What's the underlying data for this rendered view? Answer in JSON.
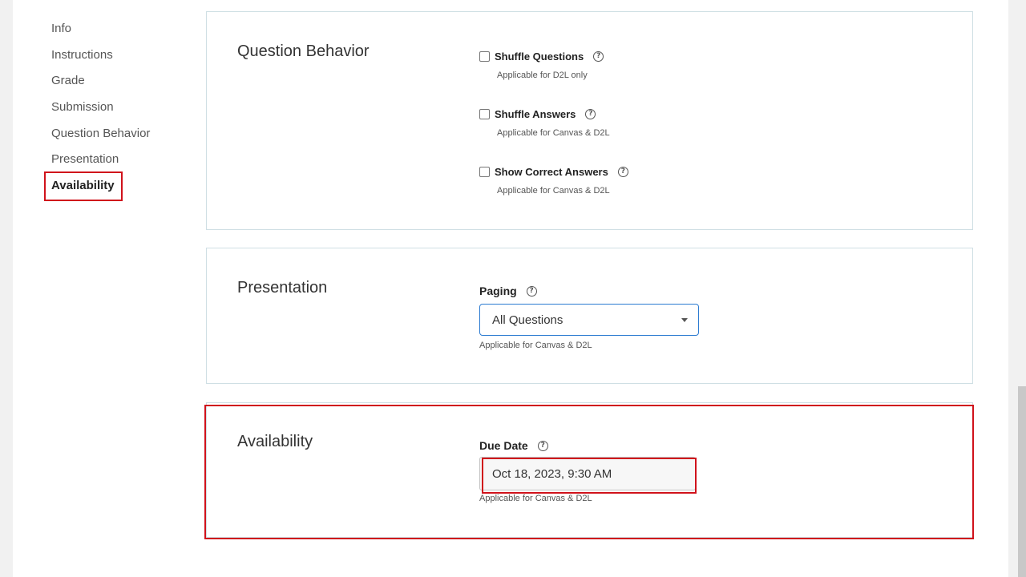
{
  "sidebar": {
    "items": [
      {
        "label": "Info"
      },
      {
        "label": "Instructions"
      },
      {
        "label": "Grade"
      },
      {
        "label": "Submission"
      },
      {
        "label": "Question Behavior"
      },
      {
        "label": "Presentation"
      },
      {
        "label": "Availability"
      }
    ],
    "active": "Availability"
  },
  "question_behavior": {
    "title": "Question Behavior",
    "options": [
      {
        "label": "Shuffle Questions",
        "checked": false,
        "hint": "Applicable for D2L only"
      },
      {
        "label": "Shuffle Answers",
        "checked": false,
        "hint": "Applicable for Canvas & D2L"
      },
      {
        "label": "Show Correct Answers",
        "checked": false,
        "hint": "Applicable for Canvas & D2L"
      }
    ]
  },
  "presentation": {
    "title": "Presentation",
    "paging_label": "Paging",
    "paging_value": "All Questions",
    "hint": "Applicable for Canvas & D2L"
  },
  "availability": {
    "title": "Availability",
    "due_date_label": "Due Date",
    "due_date_value": "Oct 18, 2023, 9:30 AM",
    "hint": "Applicable for Canvas & D2L"
  },
  "icons": {
    "help": "help-circle-icon",
    "dropdown": "chevron-down-icon"
  },
  "colors": {
    "highlight": "#d0121b",
    "focus_border": "#2c7bd1",
    "card_border": "#cfdfe4"
  }
}
